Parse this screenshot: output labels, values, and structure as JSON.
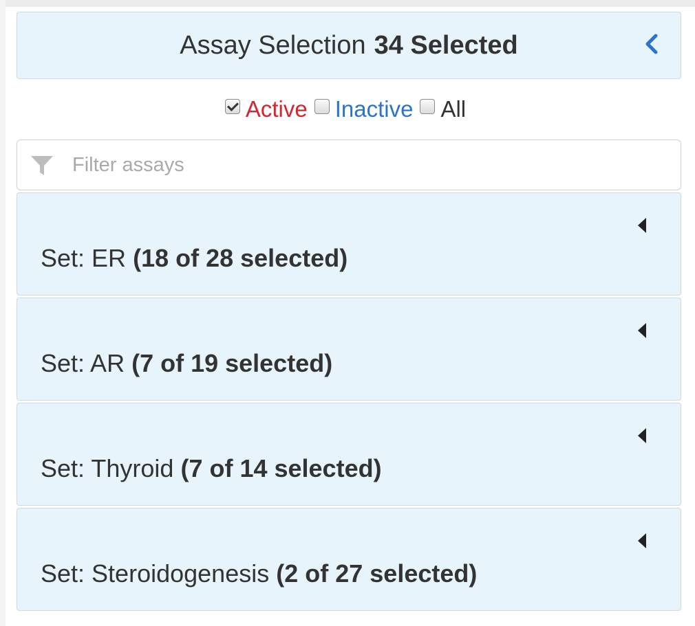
{
  "header": {
    "title": "Assay Selection",
    "selected_count": "34 Selected",
    "collapse_icon": "chevron-left-icon"
  },
  "filters": [
    {
      "label": "Active",
      "checked": true,
      "color": "#d4262e"
    },
    {
      "label": "Inactive",
      "checked": false,
      "color": "#2a74c9"
    },
    {
      "label": "All",
      "checked": false,
      "color": "#333333"
    }
  ],
  "search": {
    "icon": "filter-icon",
    "placeholder": "Filter assays",
    "value": ""
  },
  "sets": [
    {
      "name": "Set: ER",
      "count": "(18 of 28 selected)"
    },
    {
      "name": "Set: AR",
      "count": "(7 of 19 selected)"
    },
    {
      "name": "Set: Thyroid",
      "count": "(7 of 14 selected)"
    },
    {
      "name": "Set: Steroidogenesis",
      "count": "(2 of 27 selected)"
    }
  ],
  "colors": {
    "panel_bg": "#e7f4fc",
    "text": "#333333"
  }
}
